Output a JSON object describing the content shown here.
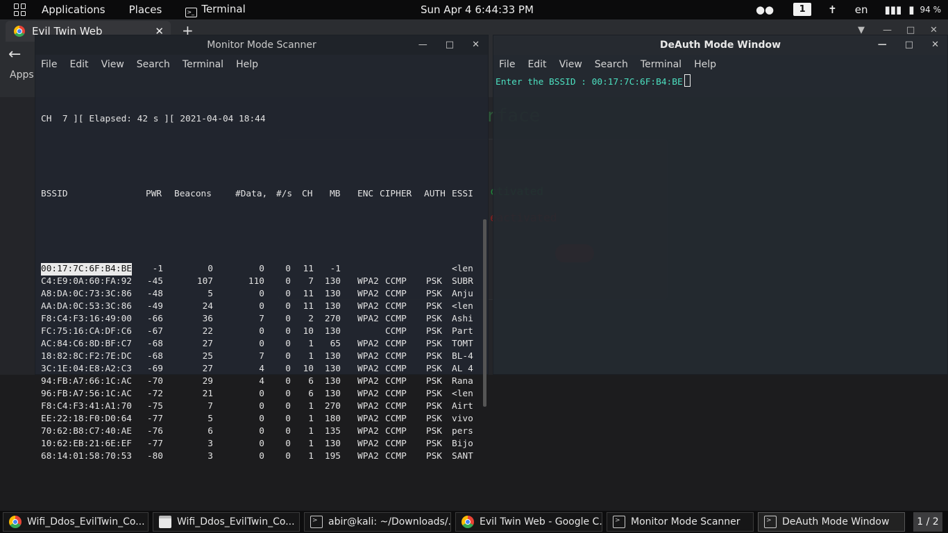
{
  "topbar": {
    "applications": "Applications",
    "places": "Places",
    "terminal": "Terminal",
    "clock": "Sun Apr 4   6:44:33 PM",
    "workspace": "1",
    "lang": "en",
    "battery": "94 %"
  },
  "browser": {
    "tab_title": "Evil Twin Web",
    "apps_label": "Apps",
    "page_heading": "rface",
    "activated": "ctivated",
    "deactivated": "eactivated"
  },
  "scanner": {
    "title": "Monitor Mode Scanner",
    "menu": [
      "File",
      "Edit",
      "View",
      "Search",
      "Terminal",
      "Help"
    ],
    "status_line": "CH  7 ][ Elapsed: 42 s ][ 2021-04-04 18:44",
    "headers": [
      "BSSID",
      "PWR",
      "Beacons",
      "#Data,",
      "#/s",
      "CH",
      "MB",
      "ENC",
      "CIPHER",
      "AUTH",
      "ESSI"
    ],
    "rows": [
      [
        "00:17:7C:6F:B4:BE",
        "-1",
        "0",
        "0",
        "0",
        "11",
        "-1",
        "",
        "",
        "",
        "<len"
      ],
      [
        "C4:E9:0A:60:FA:92",
        "-45",
        "107",
        "110",
        "0",
        "7",
        "130",
        "WPA2",
        "CCMP",
        "PSK",
        "SUBR"
      ],
      [
        "A8:DA:0C:73:3C:86",
        "-48",
        "5",
        "0",
        "0",
        "11",
        "130",
        "WPA2",
        "CCMP",
        "PSK",
        "Anju"
      ],
      [
        "AA:DA:0C:53:3C:86",
        "-49",
        "24",
        "0",
        "0",
        "11",
        "130",
        "WPA2",
        "CCMP",
        "PSK",
        "<len"
      ],
      [
        "F8:C4:F3:16:49:00",
        "-66",
        "36",
        "7",
        "0",
        "2",
        "270",
        "WPA2",
        "CCMP",
        "PSK",
        "Ashi"
      ],
      [
        "FC:75:16:CA:DF:C6",
        "-67",
        "22",
        "0",
        "0",
        "10",
        "130",
        "",
        "CCMP",
        "PSK",
        "Part"
      ],
      [
        "AC:84:C6:8D:BF:C7",
        "-68",
        "27",
        "0",
        "0",
        "1",
        "65",
        "WPA2",
        "CCMP",
        "PSK",
        "TOMT"
      ],
      [
        "18:82:8C:F2:7E:DC",
        "-68",
        "25",
        "7",
        "0",
        "1",
        "130",
        "WPA2",
        "CCMP",
        "PSK",
        "BL-4"
      ],
      [
        "3C:1E:04:E8:A2:C3",
        "-69",
        "27",
        "4",
        "0",
        "10",
        "130",
        "WPA2",
        "CCMP",
        "PSK",
        "AL 4"
      ],
      [
        "94:FB:A7:66:1C:AC",
        "-70",
        "29",
        "4",
        "0",
        "6",
        "130",
        "WPA2",
        "CCMP",
        "PSK",
        "Rana"
      ],
      [
        "96:FB:A7:56:1C:AC",
        "-72",
        "21",
        "0",
        "0",
        "6",
        "130",
        "WPA2",
        "CCMP",
        "PSK",
        "<len"
      ],
      [
        "F8:C4:F3:41:A1:70",
        "-75",
        "7",
        "0",
        "0",
        "1",
        "270",
        "WPA2",
        "CCMP",
        "PSK",
        "Airt"
      ],
      [
        "EE:22:18:F0:D0:64",
        "-77",
        "5",
        "0",
        "0",
        "1",
        "180",
        "WPA2",
        "CCMP",
        "PSK",
        "vivo"
      ],
      [
        "70:62:B8:C7:40:AE",
        "-76",
        "6",
        "0",
        "0",
        "1",
        "135",
        "WPA2",
        "CCMP",
        "PSK",
        "pers"
      ],
      [
        "10:62:EB:21:6E:EF",
        "-77",
        "3",
        "0",
        "0",
        "1",
        "130",
        "WPA2",
        "CCMP",
        "PSK",
        "Bijo"
      ],
      [
        "68:14:01:58:70:53",
        "-80",
        "3",
        "0",
        "0",
        "1",
        "195",
        "WPA2",
        "CCMP",
        "PSK",
        "SANT"
      ]
    ]
  },
  "deauth": {
    "title": "DeAuth Mode Window",
    "menu": [
      "File",
      "Edit",
      "View",
      "Search",
      "Terminal",
      "Help"
    ],
    "prompt": "Enter the BSSID : 00:17:7C:6F:B4:BE"
  },
  "taskbar": {
    "items": [
      {
        "label": "Wifi_Ddos_EvilTwin_Co...",
        "icon": "chrome-icon"
      },
      {
        "label": "Wifi_Ddos_EvilTwin_Co...",
        "icon": "folder-icon"
      },
      {
        "label": "abir@kali: ~/Downloads/...",
        "icon": "terminal-icon"
      },
      {
        "label": "Evil Twin Web - Google C...",
        "icon": "chrome-icon"
      },
      {
        "label": "Monitor Mode Scanner",
        "icon": "terminal-icon"
      },
      {
        "label": "DeAuth Mode Window",
        "icon": "terminal-icon"
      }
    ],
    "pager": "1 / 2"
  }
}
